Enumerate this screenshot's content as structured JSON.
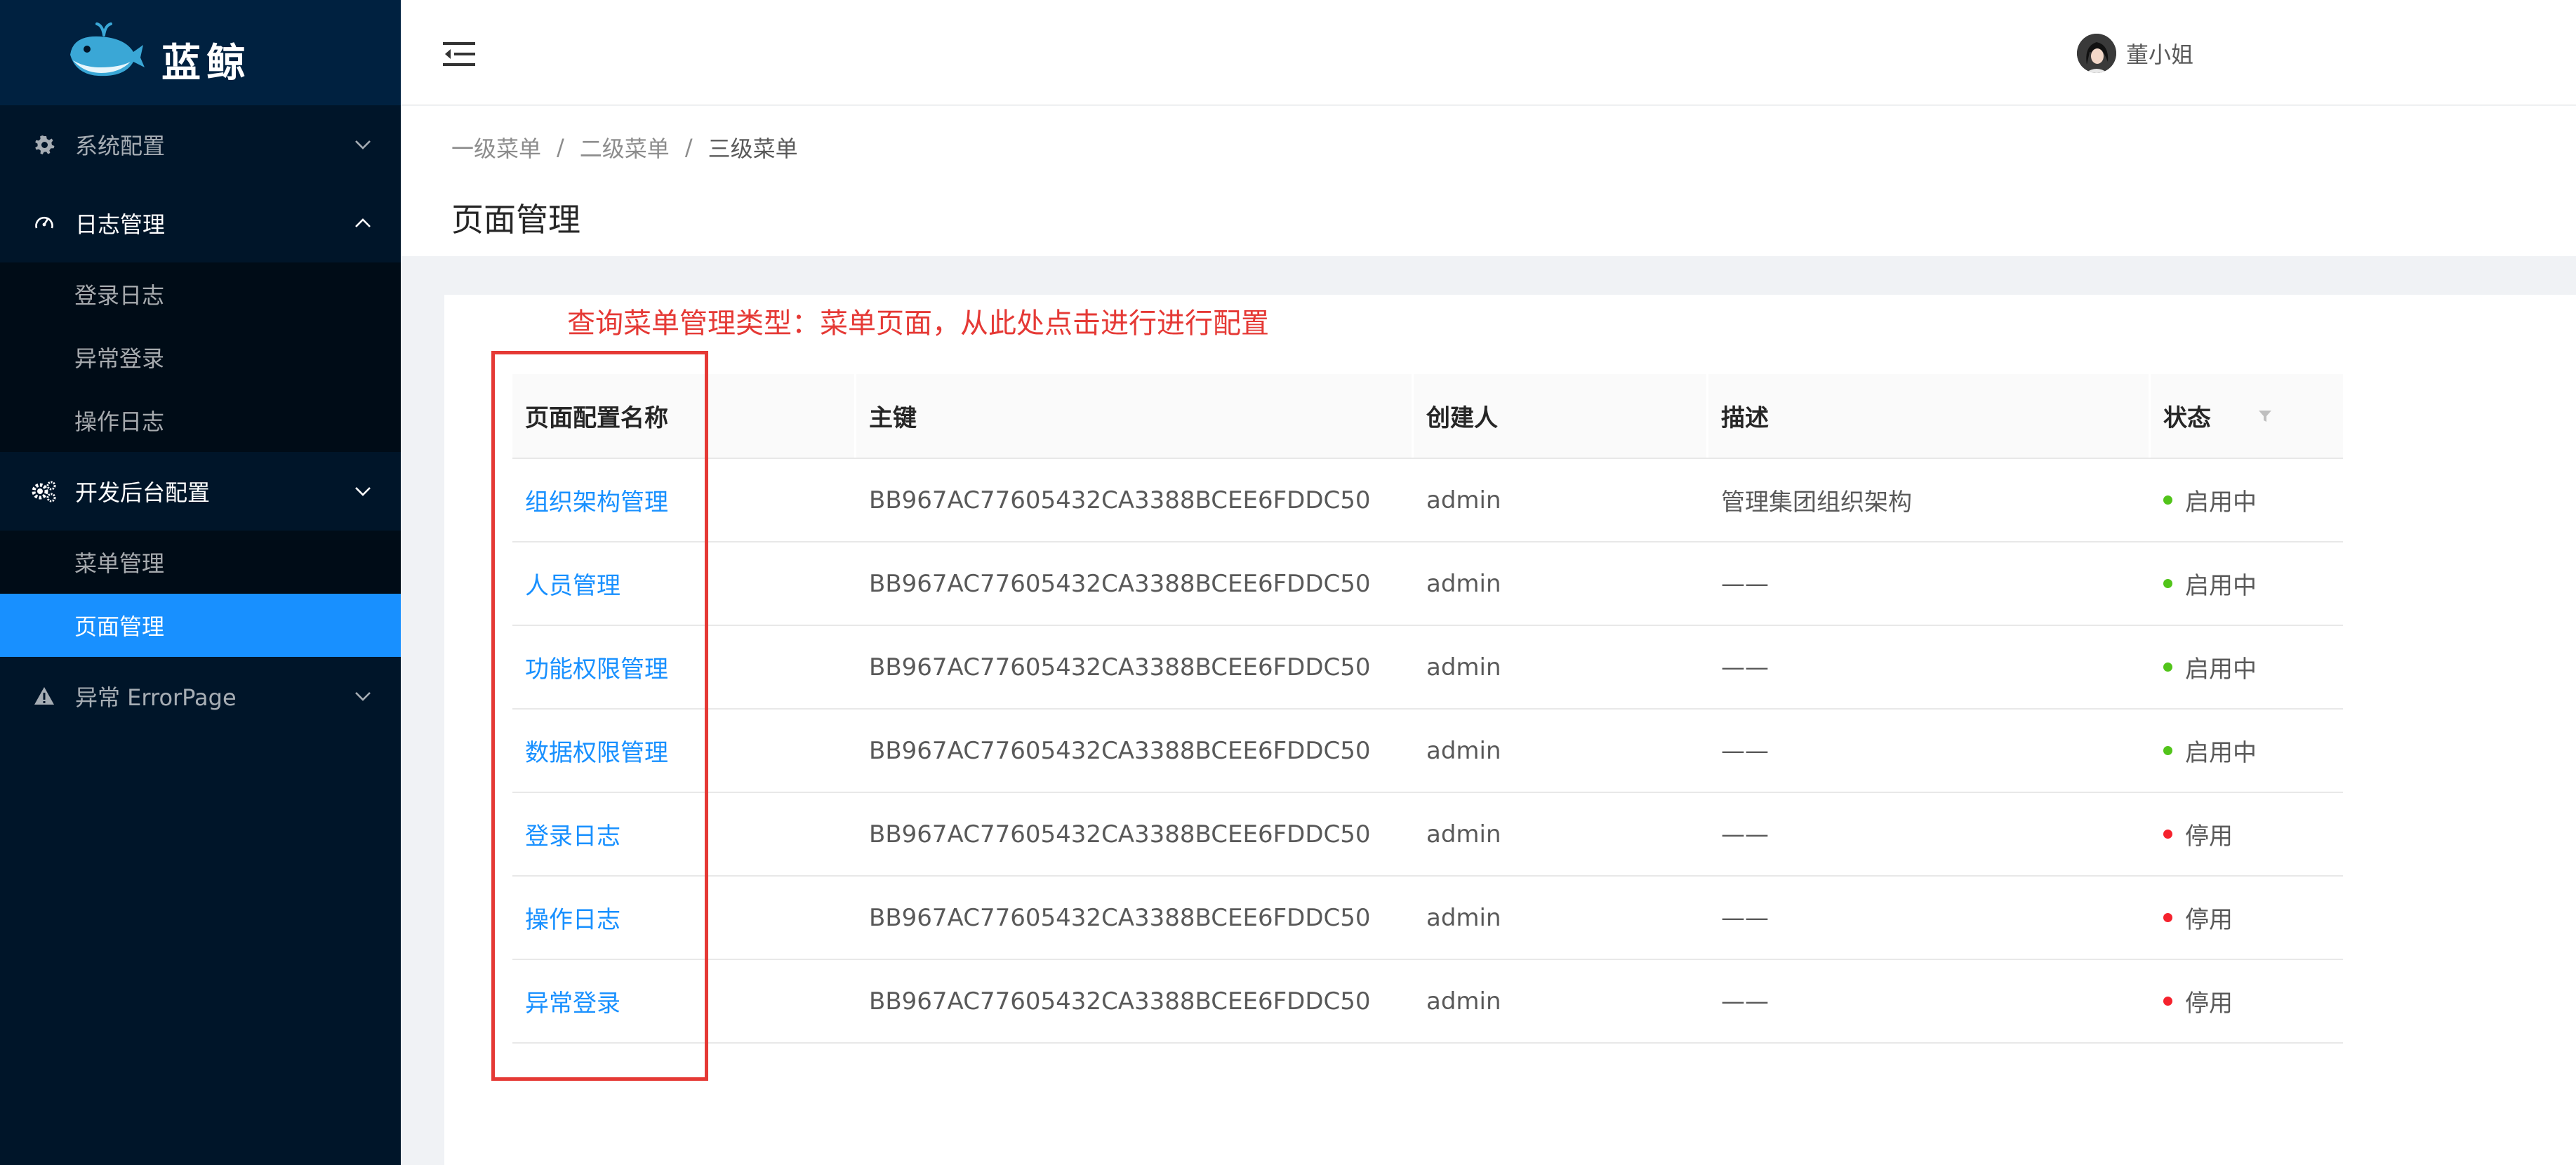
{
  "app": {
    "logo_text": "蓝鲸"
  },
  "sidebar": {
    "groups": [
      {
        "label": "系统配置",
        "icon": "gear-icon",
        "open": false,
        "items": []
      },
      {
        "label": "日志管理",
        "icon": "dashboard-icon",
        "open": true,
        "items": [
          {
            "label": "登录日志"
          },
          {
            "label": "异常登录"
          },
          {
            "label": "操作日志"
          }
        ]
      },
      {
        "label": "开发后台配置",
        "icon": "settings-gears-icon",
        "open": true,
        "items": [
          {
            "label": "菜单管理"
          },
          {
            "label": "页面管理",
            "selected": true
          }
        ]
      },
      {
        "label": "异常 ErrorPage",
        "icon": "warning-icon",
        "open": false,
        "items": []
      }
    ]
  },
  "header": {
    "user_name": "董小姐"
  },
  "breadcrumb": [
    "一级菜单",
    "二级菜单",
    "三级菜单"
  ],
  "page_title": "页面管理",
  "annotation": "查询菜单管理类型：菜单页面，从此处点击进行进行配置",
  "table": {
    "columns": [
      "页面配置名称",
      "主键",
      "创建人",
      "描述",
      "状态"
    ],
    "rows": [
      {
        "name": "组织架构管理",
        "key": "BB967AC77605432CA3388BCEE6FDDC50",
        "creator": "admin",
        "desc": "管理集团组织架构",
        "status": "启用中",
        "status_color": "#52c41a"
      },
      {
        "name": "人员管理",
        "key": "BB967AC77605432CA3388BCEE6FDDC50",
        "creator": "admin",
        "desc": "——",
        "status": "启用中",
        "status_color": "#52c41a"
      },
      {
        "name": "功能权限管理",
        "key": "BB967AC77605432CA3388BCEE6FDDC50",
        "creator": "admin",
        "desc": "——",
        "status": "启用中",
        "status_color": "#52c41a"
      },
      {
        "name": "数据权限管理",
        "key": "BB967AC77605432CA3388BCEE6FDDC50",
        "creator": "admin",
        "desc": "——",
        "status": "启用中",
        "status_color": "#52c41a"
      },
      {
        "name": "登录日志",
        "key": "BB967AC77605432CA3388BCEE6FDDC50",
        "creator": "admin",
        "desc": "——",
        "status": "停用",
        "status_color": "#f5222d"
      },
      {
        "name": "操作日志",
        "key": "BB967AC77605432CA3388BCEE6FDDC50",
        "creator": "admin",
        "desc": "——",
        "status": "停用",
        "status_color": "#f5222d"
      },
      {
        "name": "异常登录",
        "key": "BB967AC77605432CA3388BCEE6FDDC50",
        "creator": "admin",
        "desc": "——",
        "status": "停用",
        "status_color": "#f5222d"
      }
    ]
  },
  "colors": {
    "sidebar_bg": "#001529",
    "accent": "#1890ff",
    "annotation": "#e53935"
  }
}
